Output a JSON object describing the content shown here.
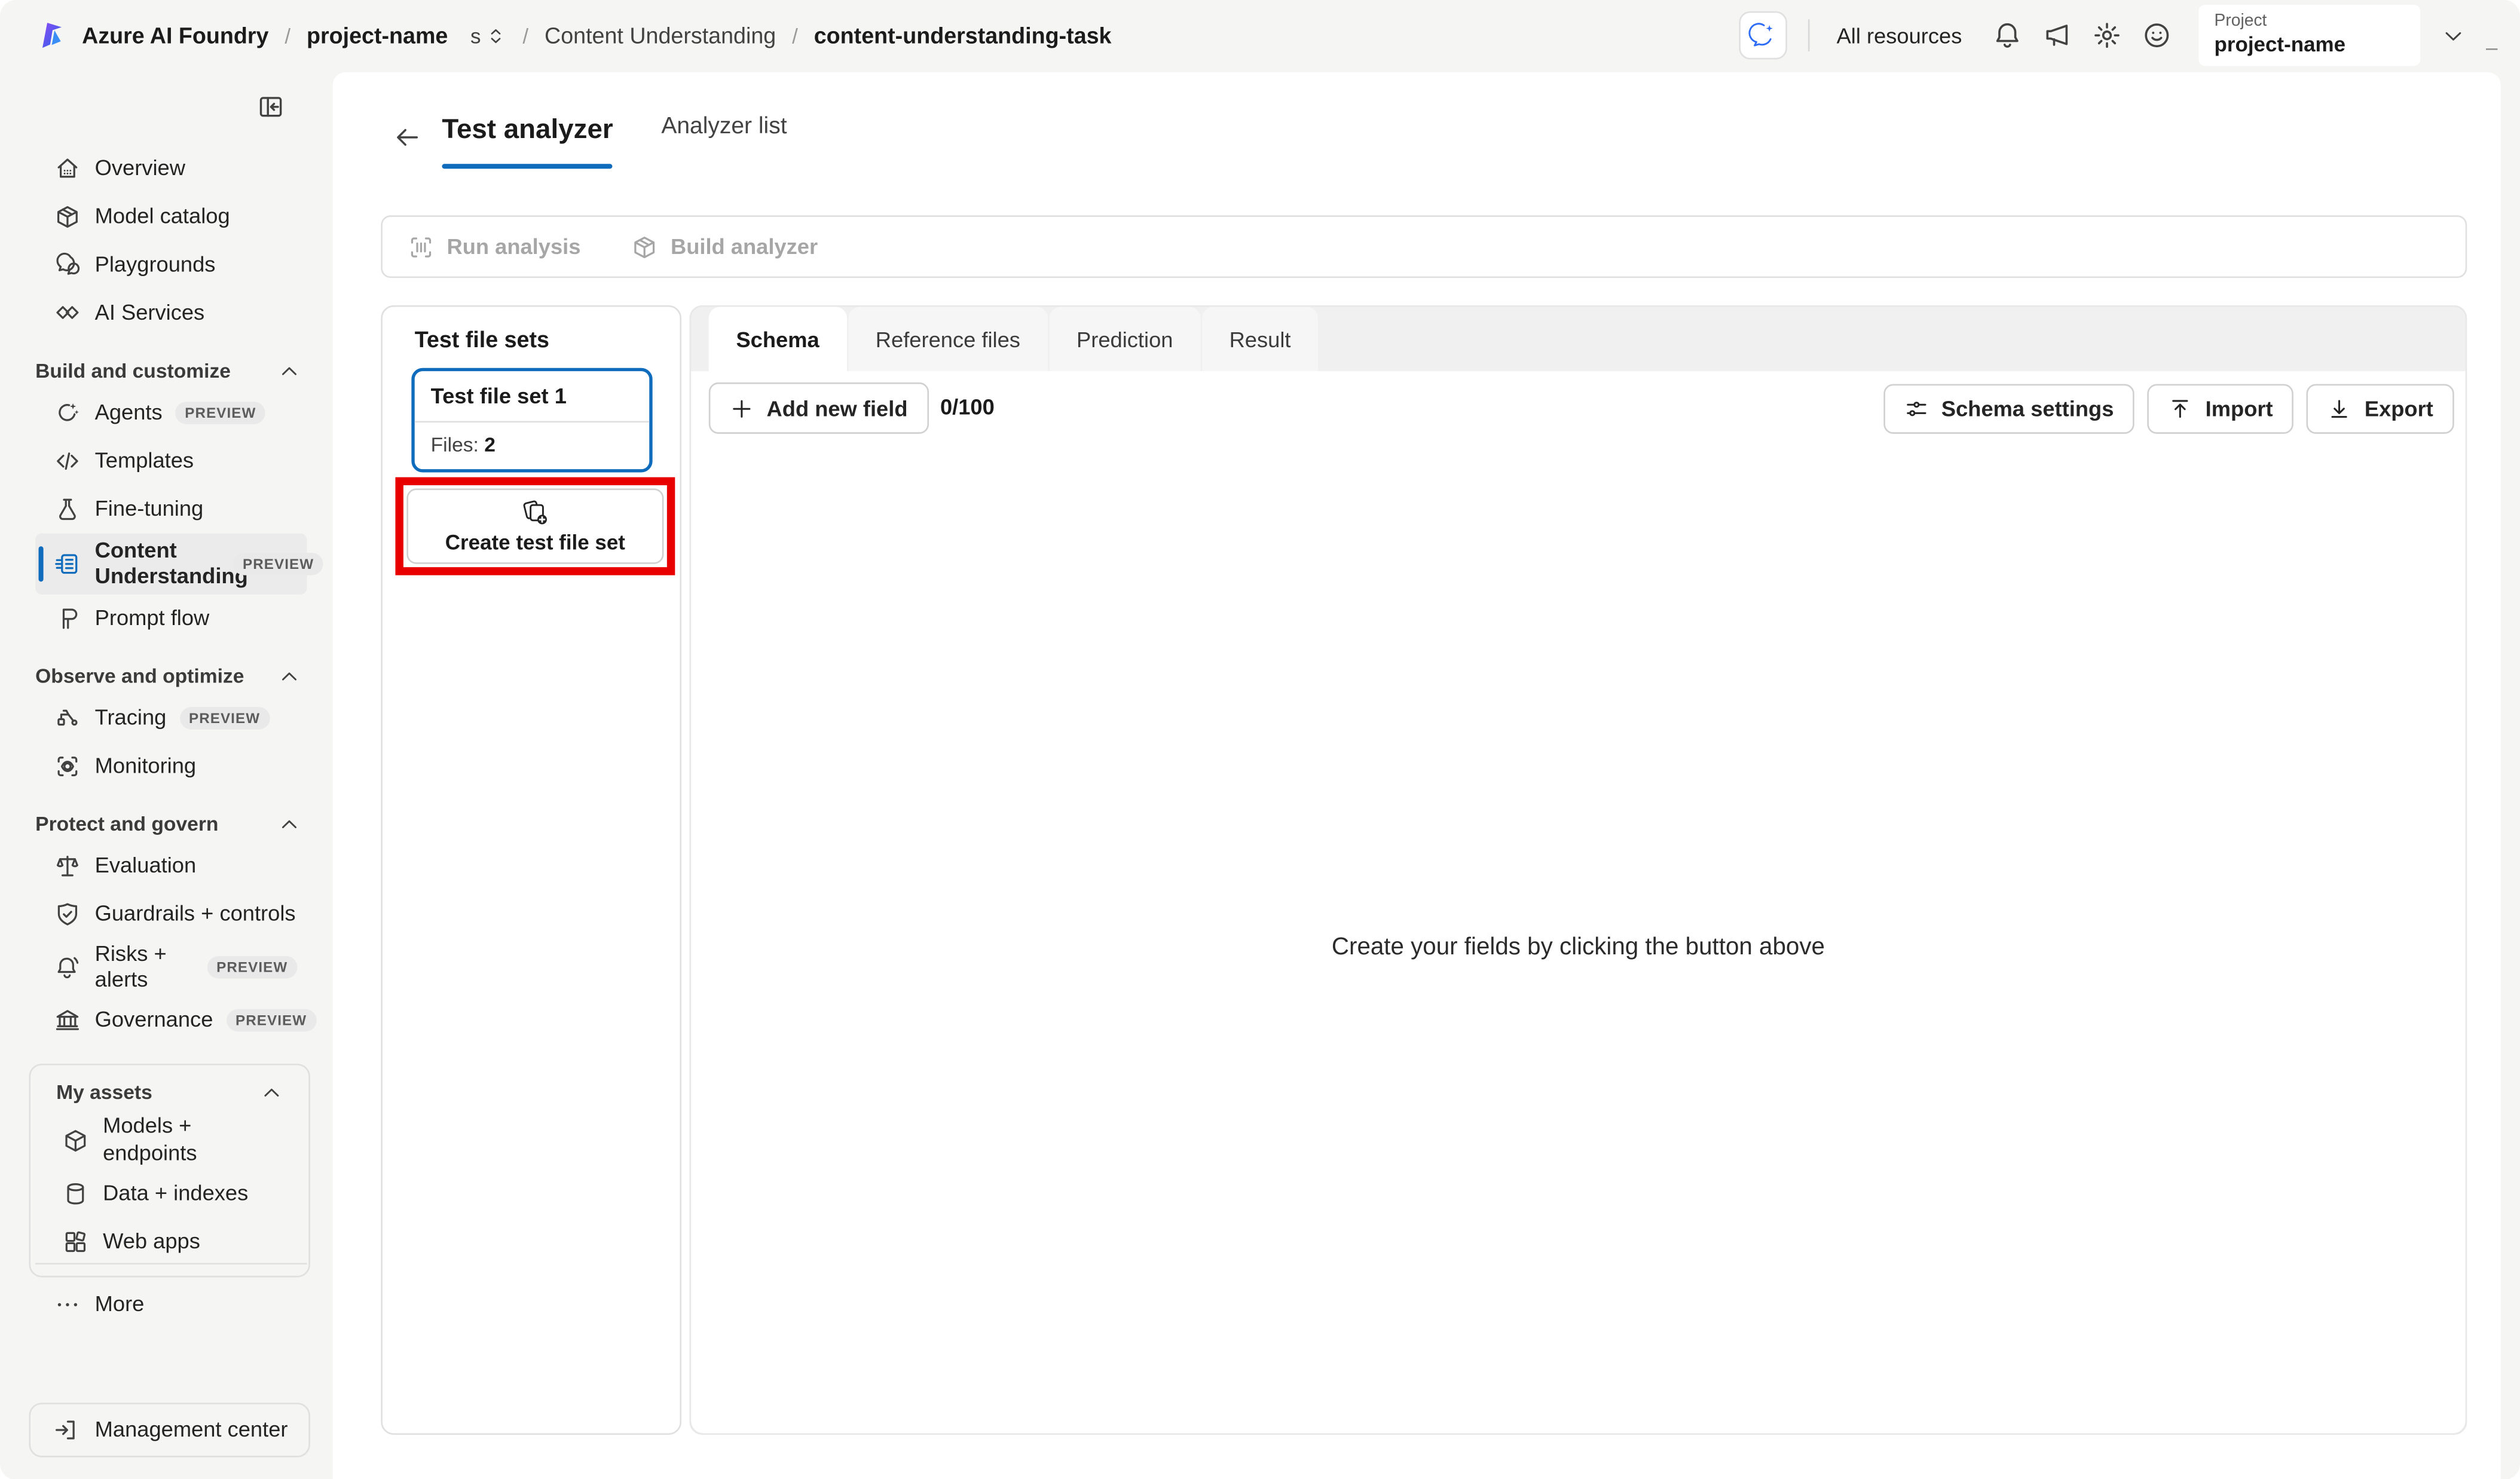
{
  "colors": {
    "accent": "#0f6cbd",
    "annotation_red": "#e80000",
    "disabled_text": "#a6a6a6",
    "surface": "#ffffff",
    "chrome_bg": "#f5f5f4"
  },
  "topbar": {
    "product": "Azure AI Foundry",
    "separator": "/",
    "breadcrumb": {
      "project": "project-name",
      "switcher_fragment": "s",
      "section": "Content Understanding",
      "task": "content-understanding-task"
    },
    "all_resources": "All resources",
    "icons": [
      "copilot-icon",
      "bell-icon",
      "megaphone-icon",
      "gear-icon",
      "smiley-icon"
    ],
    "project_selector": {
      "label": "Project",
      "value": "project-name"
    },
    "window_dash": "–"
  },
  "sidebar": {
    "top_items": [
      {
        "label": "Overview",
        "icon": "home"
      },
      {
        "label": "Model catalog",
        "icon": "model-catalog"
      },
      {
        "label": "Playgrounds",
        "icon": "playgrounds"
      },
      {
        "label": "AI Services",
        "icon": "ai-services"
      }
    ],
    "sections": [
      {
        "title": "Build and customize",
        "items": [
          {
            "label": "Agents",
            "icon": "agents",
            "badge": "PREVIEW"
          },
          {
            "label": "Templates",
            "icon": "templates"
          },
          {
            "label": "Fine-tuning",
            "icon": "fine-tuning"
          },
          {
            "label": "Content Understanding",
            "icon": "content-understanding",
            "badge": "PREVIEW",
            "selected": true
          },
          {
            "label": "Prompt flow",
            "icon": "prompt-flow"
          }
        ]
      },
      {
        "title": "Observe and optimize",
        "items": [
          {
            "label": "Tracing",
            "icon": "tracing",
            "badge": "PREVIEW"
          },
          {
            "label": "Monitoring",
            "icon": "monitoring"
          }
        ]
      },
      {
        "title": "Protect and govern",
        "items": [
          {
            "label": "Evaluation",
            "icon": "evaluation"
          },
          {
            "label": "Guardrails + controls",
            "icon": "guardrails"
          },
          {
            "label": "Risks + alerts",
            "icon": "risks-alerts",
            "badge": "PREVIEW"
          },
          {
            "label": "Governance",
            "icon": "governance",
            "badge": "PREVIEW"
          }
        ]
      },
      {
        "title": "My assets",
        "boxed": true,
        "items": [
          {
            "label": "Models + endpoints",
            "icon": "models-endpoints"
          },
          {
            "label": "Data + indexes",
            "icon": "data-indexes"
          },
          {
            "label": "Web apps",
            "icon": "web-apps"
          }
        ]
      }
    ],
    "more_label": "More",
    "management_center": "Management center"
  },
  "main": {
    "view_tabs": [
      {
        "label": "Test analyzer",
        "active": true
      },
      {
        "label": "Analyzer list",
        "active": false
      }
    ],
    "actions": [
      {
        "label": "Run analysis",
        "icon": "run-analysis",
        "disabled": true
      },
      {
        "label": "Build analyzer",
        "icon": "build-analyzer",
        "disabled": true
      }
    ],
    "test_file_sets": {
      "title": "Test file sets",
      "sets": [
        {
          "name": "Test file set 1",
          "files_label": "Files:",
          "files_count": "2",
          "selected": true
        }
      ],
      "create_label": "Create test file set"
    },
    "content_tabs": [
      {
        "label": "Schema",
        "active": true
      },
      {
        "label": "Reference files",
        "active": false
      },
      {
        "label": "Prediction",
        "active": false
      },
      {
        "label": "Result",
        "active": false
      }
    ],
    "schema_toolbar": {
      "add_field": "Add new field",
      "counter": "0/100",
      "settings": "Schema settings",
      "import": "Import",
      "export": "Export"
    },
    "empty_state": "Create your fields by clicking the button above"
  }
}
